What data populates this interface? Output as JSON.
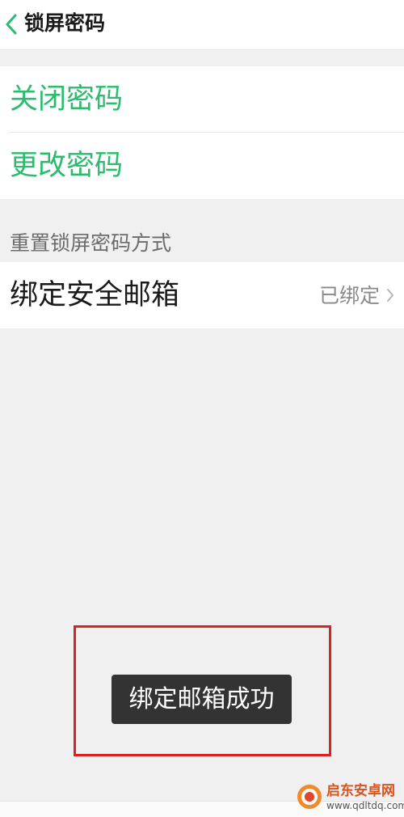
{
  "header": {
    "title": "锁屏密码"
  },
  "password_actions": [
    {
      "label": "关闭密码"
    },
    {
      "label": "更改密码"
    }
  ],
  "reset_section": {
    "title": "重置锁屏密码方式",
    "email_row": {
      "label": "绑定安全邮箱",
      "status": "已绑定"
    }
  },
  "toast": {
    "message": "绑定邮箱成功"
  },
  "watermark": {
    "title": "启东安卓网",
    "url": "www.qdltdq.com"
  },
  "colors": {
    "accent_green": "#2dbb6e",
    "highlight_red": "#e02020",
    "toast_bg": "#333333",
    "background": "#f0f0f0"
  }
}
